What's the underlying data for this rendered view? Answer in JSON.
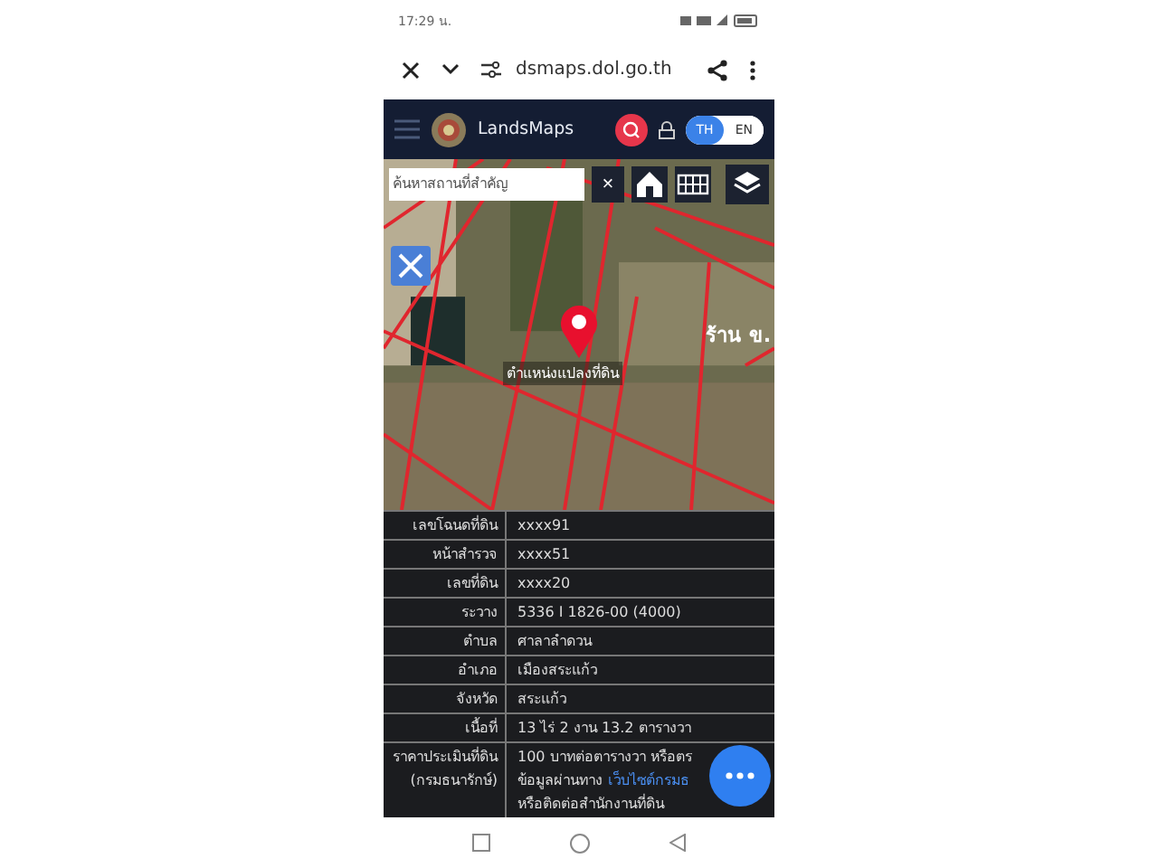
{
  "status_bar": {
    "time": "17:29 น."
  },
  "browser": {
    "url": "dsmaps.dol.go.th"
  },
  "app_header": {
    "title": "LandsMaps",
    "languages": [
      {
        "label": "TH",
        "selected": true
      },
      {
        "label": "EN",
        "selected": false
      }
    ]
  },
  "search": {
    "placeholder": "ค้นหาสถานที่สำคัญ",
    "clear": "×"
  },
  "map": {
    "labels": [
      {
        "text": "ตำแหน่งแปลงที่ดิน",
        "kind": "parcel"
      },
      {
        "text": "ร้าน ข.",
        "kind": "place"
      }
    ]
  },
  "table": {
    "rows": [
      {
        "label": "เลขโฉนดที่ดิน",
        "value": "xxxx91"
      },
      {
        "label": "หน้าสำรวจ",
        "value": "xxxx51"
      },
      {
        "label": "เลขที่ดิน",
        "value": "xxxx20"
      },
      {
        "label": "ระวาง",
        "value": "5336 I 1826-00 (4000)"
      },
      {
        "label": "ตำบล",
        "value": "ศาลาลำดวน"
      },
      {
        "label": "อำเภอ",
        "value": "เมืองสระแก้ว"
      },
      {
        "label": "จังหวัด",
        "value": "สระแก้ว"
      },
      {
        "label": "เนื้อที่",
        "value": "13 ไร่ 2 งาน 13.2 ตารางวา"
      }
    ],
    "price_row": {
      "label": "ราคาประเมินที่ดิน (กรมธนารักษ์)",
      "lines": [
        {
          "text": "100 บาทต่อตารางวา หรือตร"
        },
        {
          "text": "ข้อมูลผ่านทาง",
          "link": "เว็บไซต์กรมธ"
        },
        {
          "text": "หรือติดต่อสำนักงานที่ดิน"
        }
      ]
    }
  }
}
